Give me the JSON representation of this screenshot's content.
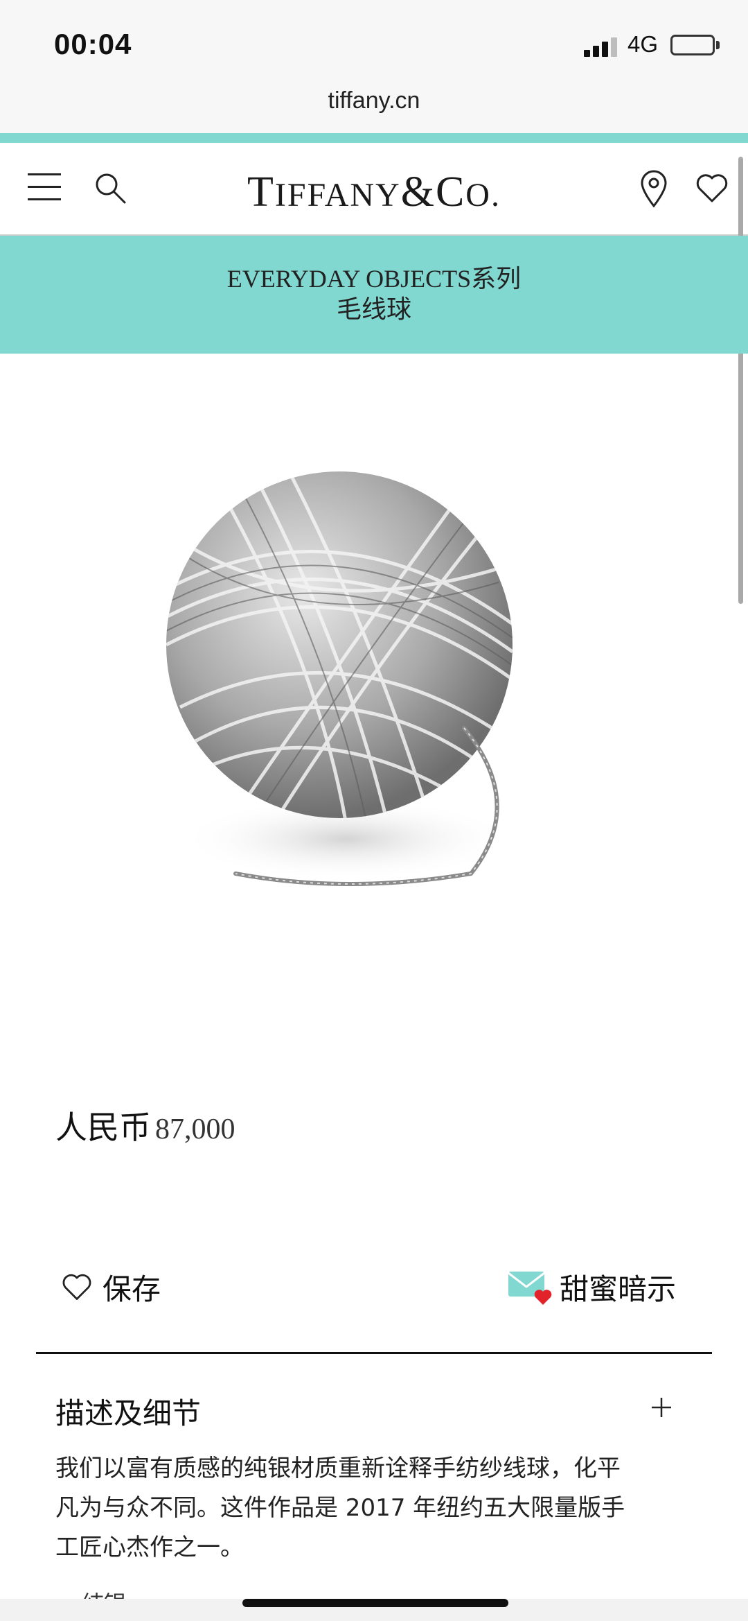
{
  "status_bar": {
    "time": "00:04",
    "network": "4G",
    "signal_bars_active": 3,
    "signal_bars_total": 4
  },
  "browser": {
    "url": "tiffany.cn"
  },
  "header": {
    "brand": {
      "T": "T",
      "iffany": "IFFANY",
      "amp": "&",
      "C": "C",
      "o": "O."
    },
    "accent_color": "#81d8d0"
  },
  "collection": {
    "series": "EVERYDAY OBJECTS系列",
    "product_name": "毛线球"
  },
  "product": {
    "currency": "人民币",
    "price": "87,000"
  },
  "actions": {
    "save_label": "保存",
    "hint_label": "甜蜜暗示"
  },
  "description": {
    "title": "描述及细节",
    "expand_symbol": "+",
    "lines": [
      "我们以富有质感的纯银材质重新诠释手纺纱线球，化平",
      "凡为与众不同。这件作品是 2017 年纽约五大限量版手",
      "工匠心杰作之一。"
    ],
    "bullet": "纯银"
  }
}
